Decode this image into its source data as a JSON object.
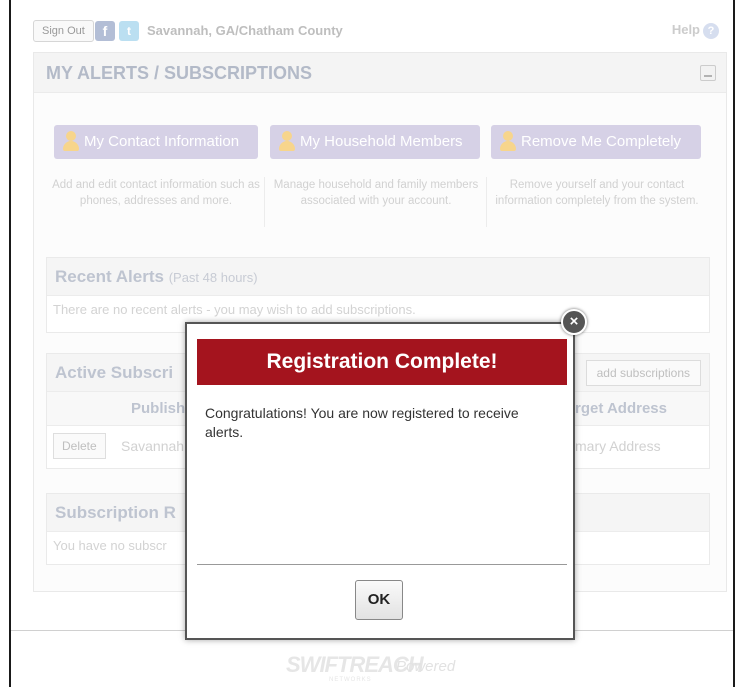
{
  "topbar": {
    "signout_label": "Sign Out",
    "facebook_glyph": "f",
    "twitter_glyph": "t",
    "org_name": "Savannah, GA/Chatham County",
    "help_label": "Help",
    "help_glyph": "?"
  },
  "panel": {
    "title": "MY ALERTS / SUBSCRIPTIONS"
  },
  "actions": [
    {
      "label": "My Contact Information",
      "description": "Add and edit contact information such as phones, addresses and more."
    },
    {
      "label": "My Household Members",
      "description": "Manage household and family members associated with your account."
    },
    {
      "label": "Remove Me Completely",
      "description": "Remove yourself and your contact information completely from the system."
    }
  ],
  "recent_alerts": {
    "title": "Recent Alerts",
    "subtitle": "(Past 48 hours)",
    "message": "There are no recent alerts - you may wish to add subscriptions."
  },
  "active_subscriptions": {
    "title": "Active Subscri",
    "add_button": "add subscriptions",
    "col_publisher": "Publishe",
    "col_target": "rget Address",
    "row": {
      "delete_label": "Delete",
      "publisher": "Savannah",
      "target": "mary Address"
    }
  },
  "subscription_requests": {
    "title": "Subscription R",
    "message": "You have no subscr"
  },
  "footer": {
    "logo": "SWIFTREACH",
    "powered": "Powered",
    "networks": "NETWORKS"
  },
  "modal": {
    "title": "Registration Complete!",
    "message": "Congratulations! You are now registered to receive alerts.",
    "ok_label": "OK",
    "close_glyph": "×"
  },
  "colors": {
    "modal_title_bg": "#a4141e",
    "action_button_bg": "#c9c2de"
  }
}
